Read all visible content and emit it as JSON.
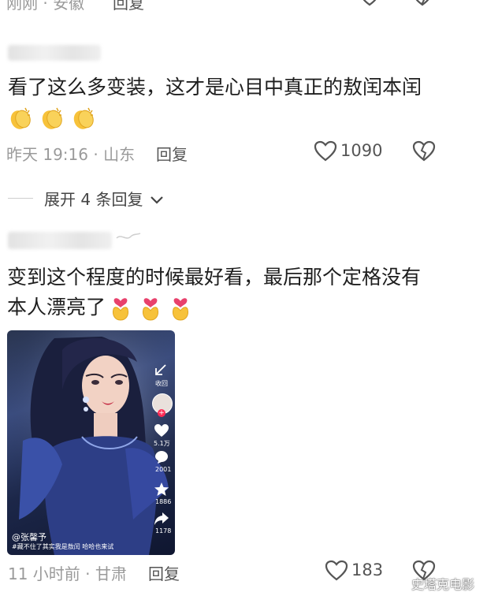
{
  "top_partial": {
    "meta": "刚刚 · 安徽",
    "reply_label": "回复"
  },
  "comment1": {
    "text": "看了这么多变装，这才是心目中真正的敖闰本闰",
    "emoji": [
      "clap-emoji",
      "clap-emoji",
      "clap-emoji"
    ],
    "meta": "昨天 19:16 · 山东",
    "reply_label": "回复",
    "like_count": "1090",
    "expand_label": "展开 4 条回复"
  },
  "comment2": {
    "text_line1": "变到这个程度的时候最好看，最后那个定格没有",
    "text_line2": "本人漂亮了",
    "emoji": [
      "heart-hands-emoji",
      "heart-hands-emoji",
      "heart-hands-emoji"
    ],
    "video": {
      "author": "@张馨予",
      "caption": "#藏不住了其实我是敖闰  哈哈也来试",
      "collapse_label": "收回",
      "counts": [
        "5.1万",
        "2001",
        "1886",
        "1178"
      ]
    },
    "meta": "11 小时前 · 甘肃",
    "reply_label": "回复",
    "like_count": "183"
  },
  "watermark": "史塔克电影",
  "colors": {
    "text": "#1e1e1e",
    "meta": "#9a9a9a",
    "icon": "#555555",
    "emoji_yellow": "#f7c23a",
    "heart_red": "#e8416c"
  }
}
